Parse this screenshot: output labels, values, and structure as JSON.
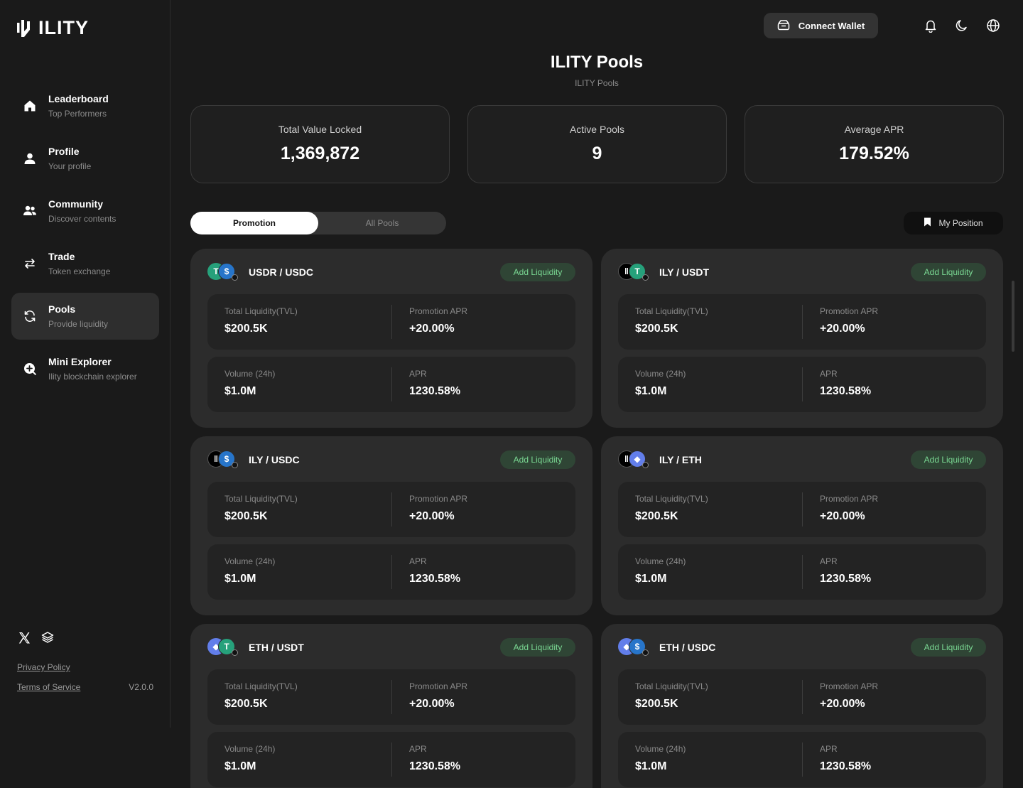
{
  "brand": {
    "name": "ILITY"
  },
  "sidebar": {
    "items": [
      {
        "title": "Leaderboard",
        "sub": "Top Performers",
        "icon": "home-icon"
      },
      {
        "title": "Profile",
        "sub": "Your profile",
        "icon": "user-icon"
      },
      {
        "title": "Community",
        "sub": "Discover contents",
        "icon": "people-icon"
      },
      {
        "title": "Trade",
        "sub": "Token exchange",
        "icon": "swap-icon"
      },
      {
        "title": "Pools",
        "sub": "Provide liquidity",
        "icon": "refresh-icon",
        "active": true
      },
      {
        "title": "Mini Explorer",
        "sub": "Ility blockchain explorer",
        "icon": "explorer-icon"
      }
    ],
    "privacy": "Privacy Policy",
    "terms": "Terms of Service",
    "version": "V2.0.0"
  },
  "header": {
    "connect_label": "Connect Wallet"
  },
  "page": {
    "title": "ILITY Pools",
    "subtitle": "ILITY Pools"
  },
  "stats": [
    {
      "label": "Total Value Locked",
      "value": "1,369,872"
    },
    {
      "label": "Active Pools",
      "value": "9"
    },
    {
      "label": "Average APR",
      "value": "179.52%"
    }
  ],
  "tabs": {
    "promotion": "Promotion",
    "all": "All Pools",
    "my_position": "My Position"
  },
  "labels": {
    "tvl": "Total Liquidity(TVL)",
    "promo_apr": "Promotion APR",
    "volume": "Volume (24h)",
    "apr": "APR",
    "add": "Add Liquidity"
  },
  "pools": [
    {
      "name": "USDR / USDC",
      "tvl": "$200.5K",
      "promo_apr": "+20.00%",
      "volume": "$1.0M",
      "apr": "1230.58%",
      "coin_a": "usdr",
      "coin_b": "usdc"
    },
    {
      "name": "ILY / USDT",
      "tvl": "$200.5K",
      "promo_apr": "+20.00%",
      "volume": "$1.0M",
      "apr": "1230.58%",
      "coin_a": "ily",
      "coin_b": "usdt"
    },
    {
      "name": "ILY / USDC",
      "tvl": "$200.5K",
      "promo_apr": "+20.00%",
      "volume": "$1.0M",
      "apr": "1230.58%",
      "coin_a": "ily",
      "coin_b": "usdc"
    },
    {
      "name": "ILY / ETH",
      "tvl": "$200.5K",
      "promo_apr": "+20.00%",
      "volume": "$1.0M",
      "apr": "1230.58%",
      "coin_a": "ily",
      "coin_b": "eth"
    },
    {
      "name": "ETH / USDT",
      "tvl": "$200.5K",
      "promo_apr": "+20.00%",
      "volume": "$1.0M",
      "apr": "1230.58%",
      "coin_a": "eth",
      "coin_b": "usdt"
    },
    {
      "name": "ETH / USDC",
      "tvl": "$200.5K",
      "promo_apr": "+20.00%",
      "volume": "$1.0M",
      "apr": "1230.58%",
      "coin_a": "eth",
      "coin_b": "usdc"
    }
  ],
  "colors": {
    "accent_green": "#7ad893",
    "usdt": "#26a17b",
    "usdc": "#2775ca",
    "eth": "#627eea"
  }
}
